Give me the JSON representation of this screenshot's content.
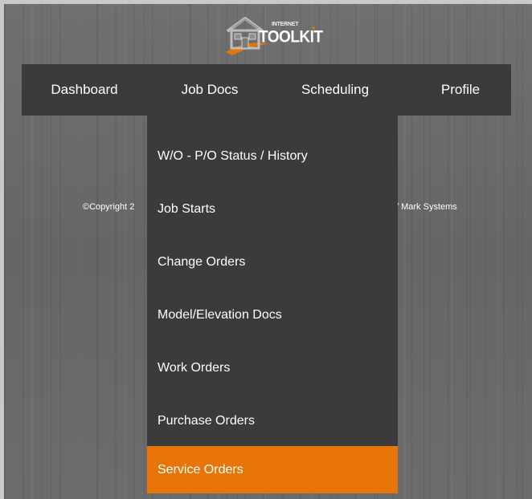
{
  "logo": {
    "small_text": "INTERNET",
    "word": "TOOLKIT",
    "accent_color": "#e8750a"
  },
  "nav": {
    "items": [
      {
        "label": "Dashboard"
      },
      {
        "label": "Job Docs"
      },
      {
        "label": "Scheduling"
      },
      {
        "label": "Profile"
      }
    ]
  },
  "footer": {
    "copyright_left": "©Copyright 2",
    "copyright_right": "/ Mark Systems"
  },
  "dropdown": {
    "items": [
      {
        "label": "W/O - P/O Status / History"
      },
      {
        "label": "Job Starts"
      },
      {
        "label": "Change Orders"
      },
      {
        "label": "Model/Elevation Docs"
      },
      {
        "label": "Work Orders"
      },
      {
        "label": "Purchase Orders"
      },
      {
        "label": "Service Orders",
        "active": true
      }
    ]
  },
  "colors": {
    "nav_background": "#3b3b3b",
    "active_item": "#e8750a",
    "text": "#ffffff"
  }
}
